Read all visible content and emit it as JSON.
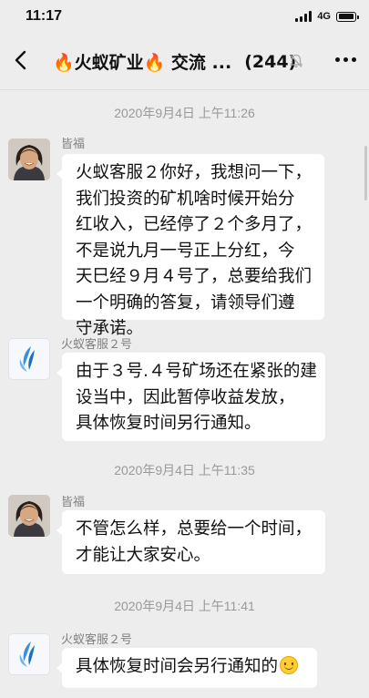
{
  "status": {
    "time": "11:17",
    "network": "4G"
  },
  "header": {
    "title": "🔥火蚁矿业🔥 交流 ...",
    "member_count": "(244)"
  },
  "messages": [
    {
      "timestamp": "2020年9月4日 上午11:26"
    },
    {
      "sender": "皆福",
      "lines": [
        "火蚁客服２你好，我想问一下，",
        "我们投资的矿机啥时候开始分",
        "红收入，已经停了２个多月了，",
        "不是说九月一号正上分红，今",
        "天巳经９月４号了，总要给我们",
        "一个明确的答复，请领导们遵",
        "守承诺。"
      ]
    },
    {
      "sender": "火蚁客服２号",
      "lines": [
        "由于３号.４号矿场还在紧张的建",
        "设当中，因此暂停收益发放，",
        "具体恢复时间另行通知。"
      ]
    },
    {
      "timestamp": "2020年9月4日 上午11:35"
    },
    {
      "sender": "皆福",
      "lines": [
        "不管怎么样，总要给一个时间，",
        "才能让大家安心。"
      ]
    },
    {
      "timestamp": "2020年9月4日 上午11:41"
    },
    {
      "sender": "火蚁客服２号",
      "lines": [
        "具体恢复时间会另行通知的"
      ],
      "emoji": "smile-emoji"
    }
  ],
  "colors": {
    "background": "#ededed",
    "bubble": "#ffffff",
    "timestamp": "#999999",
    "sender": "#808080"
  }
}
